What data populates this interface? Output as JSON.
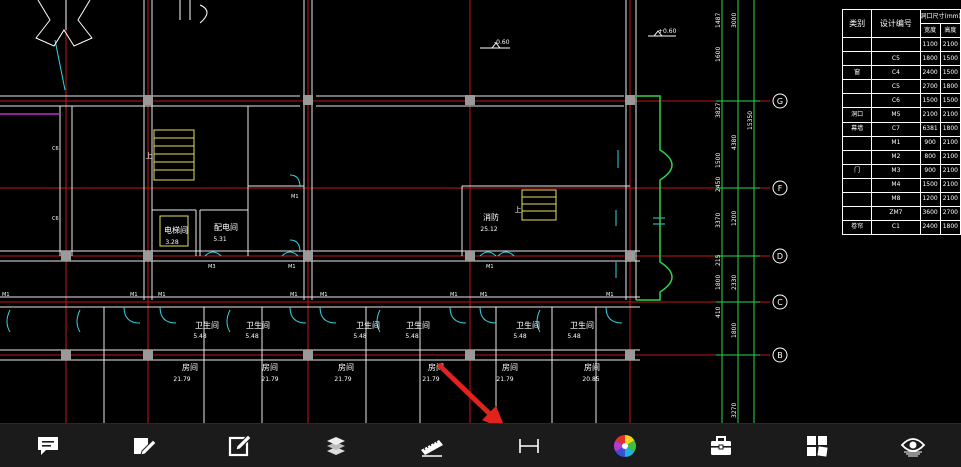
{
  "drawing": {
    "rooms": [
      {
        "name": "电梯间",
        "area": "3.28"
      },
      {
        "name": "配电间",
        "area": "5.31"
      },
      {
        "name": "消防",
        "area": "25.12"
      },
      {
        "name": "卫生间",
        "area": "5.48"
      },
      {
        "name": "房间",
        "area": "21.79"
      },
      {
        "name": "房间",
        "area": "20.85"
      }
    ],
    "stair_label": "上",
    "door_label": "M1",
    "door_label_m3": "M3",
    "window_label": "C6",
    "elevation_top": "-0.60",
    "elevation_right": "+0.60",
    "axis_labels": [
      "G",
      "F",
      "D",
      "C",
      "B"
    ],
    "dimensions": [
      "1487",
      "1600",
      "3000",
      "3827",
      "4380",
      "1500",
      "2450",
      "3370",
      "215",
      "1200",
      "1800",
      "2330",
      "410",
      "1800",
      "3270",
      "15350"
    ]
  },
  "schedule": {
    "headers": [
      "类别",
      "设计编号",
      "洞口尺寸(mm)"
    ],
    "subheaders": [
      "宽度",
      "高度"
    ],
    "rows": [
      {
        "cat": "",
        "code": "",
        "w": "1100",
        "h": "2100"
      },
      {
        "cat": "",
        "code": "C5",
        "w": "1800",
        "h": "1500"
      },
      {
        "cat": "窗",
        "code": "C4",
        "w": "2400",
        "h": "1500"
      },
      {
        "cat": "",
        "code": "C5",
        "w": "2700",
        "h": "1800"
      },
      {
        "cat": "",
        "code": "C6",
        "w": "1500",
        "h": "1500"
      },
      {
        "cat": "洞口",
        "code": "M5",
        "w": "2100",
        "h": "2100"
      },
      {
        "cat": "幕墙",
        "code": "C7",
        "w": "6381",
        "h": "1800"
      },
      {
        "cat": "",
        "code": "M1",
        "w": "900",
        "h": "2100"
      },
      {
        "cat": "",
        "code": "M2",
        "w": "800",
        "h": "2100"
      },
      {
        "cat": "门",
        "code": "M3",
        "w": "900",
        "h": "2100"
      },
      {
        "cat": "",
        "code": "M4",
        "w": "1500",
        "h": "2100"
      },
      {
        "cat": "",
        "code": "M8",
        "w": "1200",
        "h": "2100"
      },
      {
        "cat": "",
        "code": "ZM7",
        "w": "3600",
        "h": "2700"
      },
      {
        "cat": "卷帘",
        "code": "C1",
        "w": "2400",
        "h": "1800"
      }
    ]
  },
  "toolbar": {
    "buttons": [
      {
        "name": "comment-button",
        "icon": "comment-icon"
      },
      {
        "name": "markup-button",
        "icon": "pencil-markup-icon"
      },
      {
        "name": "edit-button",
        "icon": "edit-icon"
      },
      {
        "name": "layers-button",
        "icon": "layers-icon"
      },
      {
        "name": "measure-button",
        "icon": "ruler-icon"
      },
      {
        "name": "dimension-button",
        "icon": "dimension-icon"
      },
      {
        "name": "color-button",
        "icon": "color-wheel-icon"
      },
      {
        "name": "toolbox-button",
        "icon": "toolbox-icon"
      },
      {
        "name": "layout-button",
        "icon": "layout-icon"
      },
      {
        "name": "view-button",
        "icon": "eye-icon"
      }
    ],
    "highlight_color": "#e0231c"
  }
}
